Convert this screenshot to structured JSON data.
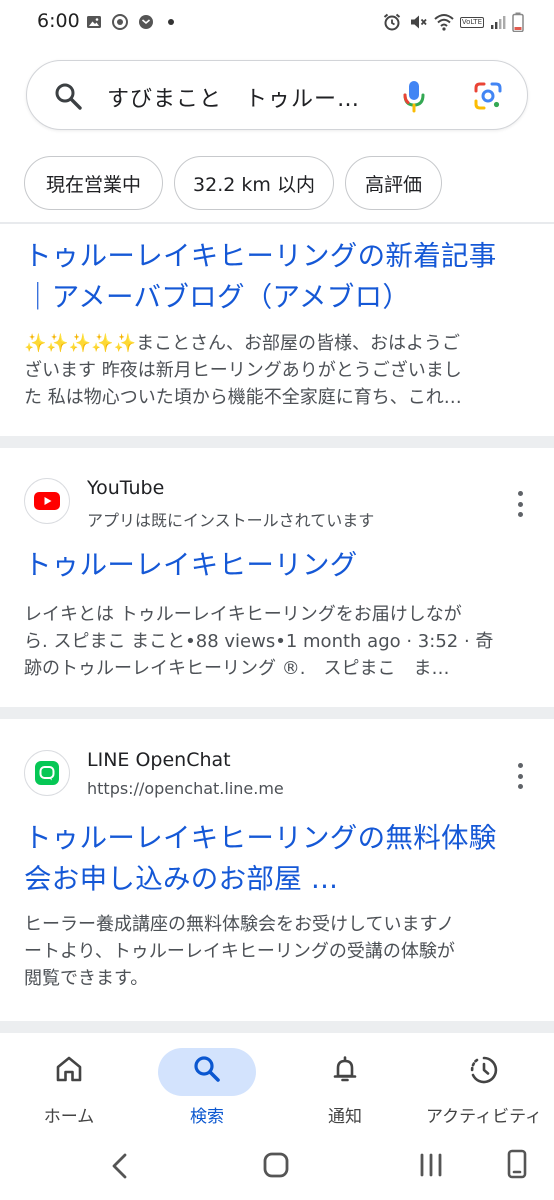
{
  "status_bar": {
    "time": "6:00",
    "left_icons": [
      "image-icon",
      "sync-icon",
      "notification-icon",
      "dot-icon"
    ],
    "right_icons": [
      "alarm-icon",
      "mute-icon",
      "wifi-icon",
      "volte-icon",
      "signal-icon",
      "battery-icon"
    ],
    "volte_text": "VoLTE"
  },
  "search": {
    "query": "すびまこと　トゥルー…"
  },
  "chips": [
    {
      "label": "現在営業中"
    },
    {
      "label": "32.2 km 以内"
    },
    {
      "label": "高評価"
    }
  ],
  "results": [
    {
      "title_line1": "トゥルーレイキヒーリングの新着記事",
      "title_line2": "｜アメーバブログ（アメブロ）",
      "snippet_sparkles": "✨✨✨✨✨",
      "snippet_line1": "まことさん、お部屋の皆様、おはようご",
      "snippet_line2": "ざいます 昨夜は新月ヒーリングありがとうございまし",
      "snippet_line3": "た 私は物心ついた頃から機能不全家庭に育ち、これ…"
    },
    {
      "site_name": "YouTube",
      "site_sub": "アプリは既にインストールされています",
      "title_line1": "トゥルーレイキヒーリング",
      "snippet_line1": "レイキとは トゥルーレイキヒーリングをお届けしなが",
      "snippet_line2": "ら. スピまこ まこと•88 views•1 month ago · 3:52 · 奇",
      "snippet_line3": "跡のトゥルーレイキヒーリング ®.　スピまこ　ま…"
    },
    {
      "site_name": "LINE OpenChat",
      "site_sub": "https://openchat.line.me",
      "title_line1": "トゥルーレイキヒーリングの無料体験",
      "title_line2": "会お申し込みのお部屋 ...",
      "snippet_line1": "ヒーラー養成講座の無料体験会をお受けしていますノ",
      "snippet_line2": "ートより、トゥルーレイキヒーリングの受講の体験が",
      "snippet_line3": "閲覧できます。"
    }
  ],
  "bottom_nav": [
    {
      "label": "ホーム",
      "icon": "home-icon"
    },
    {
      "label": "検索",
      "icon": "search-icon",
      "active": true
    },
    {
      "label": "通知",
      "icon": "bell-icon"
    },
    {
      "label": "アクティビティ",
      "icon": "activity-icon"
    }
  ],
  "colors": {
    "link": "#1a0dab",
    "accent": "#0b57d0",
    "active_pill": "#d3e3fd",
    "youtube_red": "#ff0000",
    "line_green": "#06c755"
  }
}
